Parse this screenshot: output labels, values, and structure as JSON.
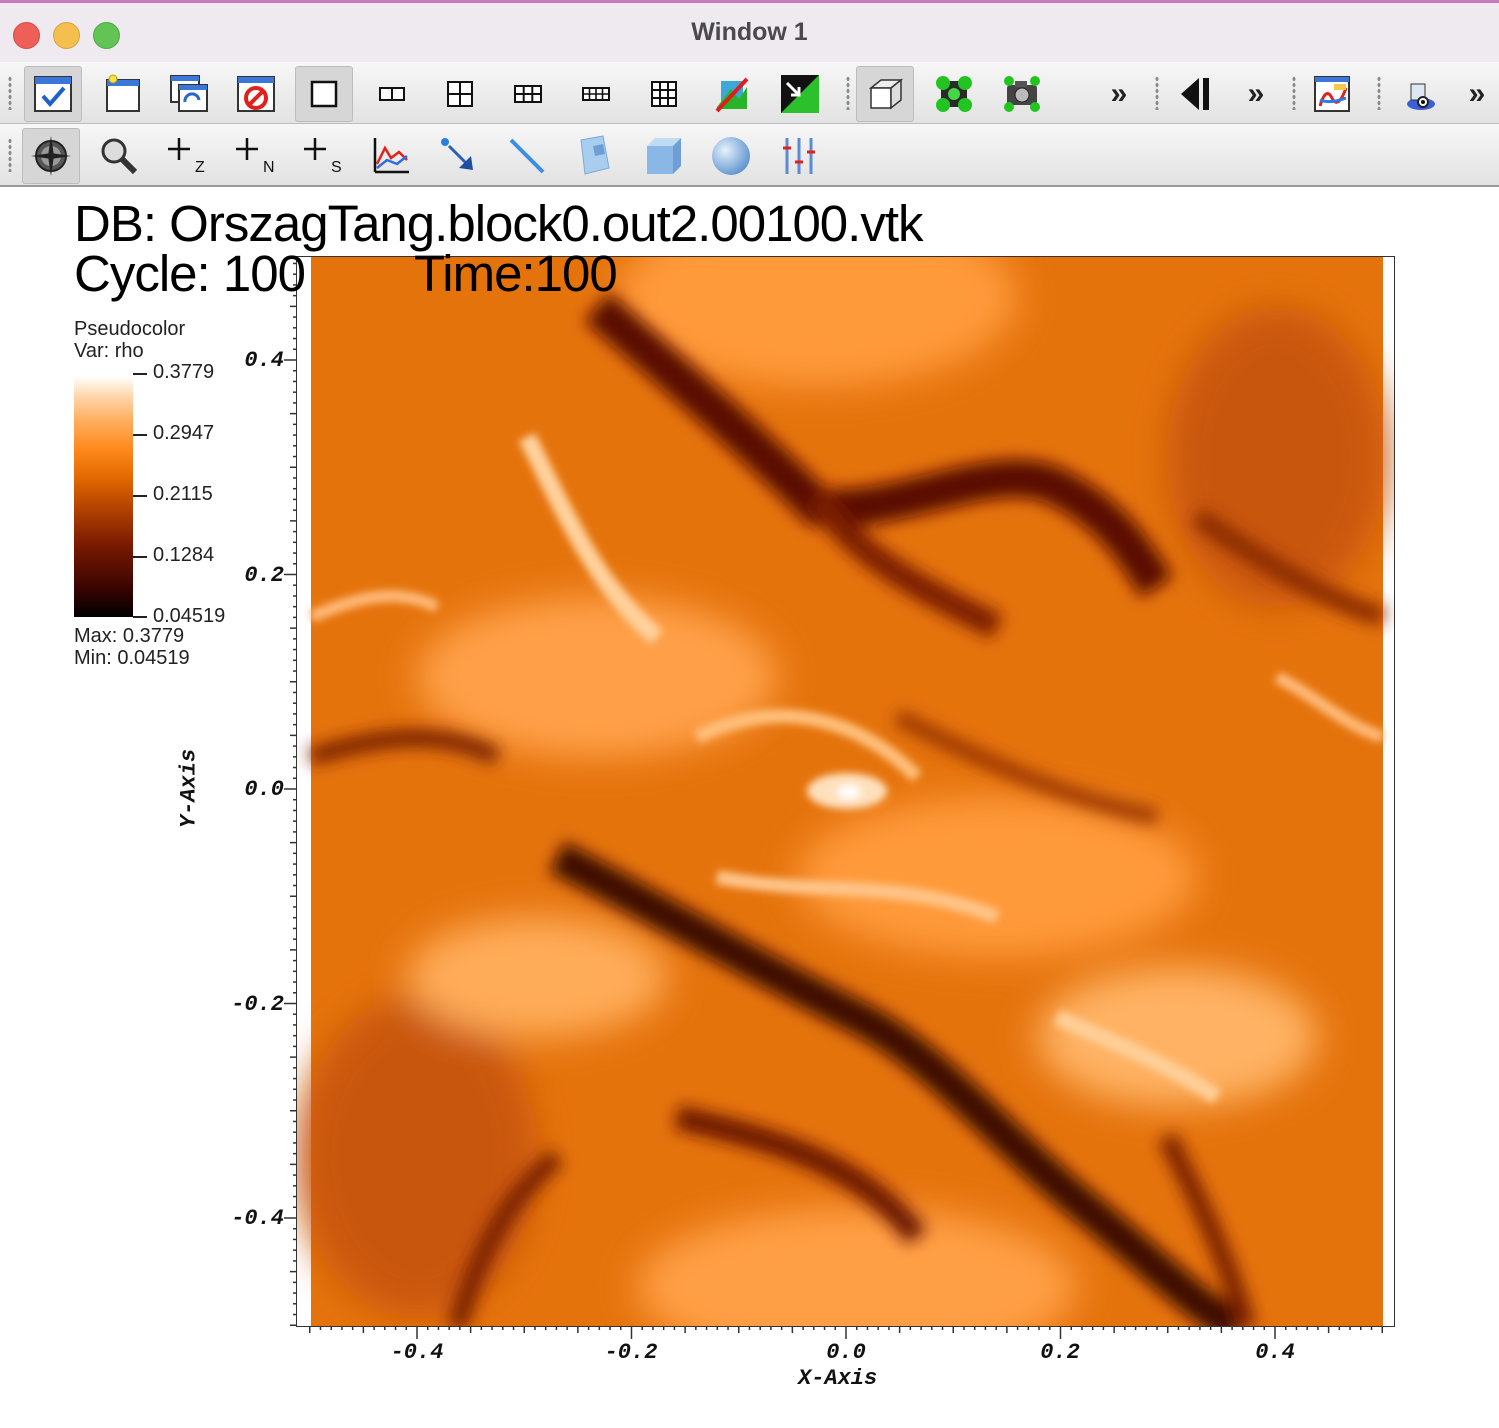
{
  "window": {
    "title": "Window 1"
  },
  "toolbar1": {
    "buttons": [
      "active-window-icon",
      "new-window-icon",
      "clone-window-icon",
      "delete-window-icon",
      "layout-1x1-icon",
      "layout-1x2-icon",
      "layout-2x2-icon",
      "layout-2x3-icon",
      "layout-2x4-icon",
      "layout-3x3-icon",
      "lock-view-icon",
      "invert-view-icon",
      "perspective-icon",
      "copy-attributes-icon",
      "camera-icon",
      "overflow-chevron-icon",
      "animation-reverse-icon",
      "overflow-chevron-icon",
      "color-table-icon",
      "spin-mode-icon",
      "overflow-chevron-icon"
    ],
    "more_label": "»"
  },
  "toolbar2": {
    "buttons": [
      "navigate-icon",
      "zoom-icon",
      "zone-pick-icon",
      "node-pick-icon",
      "spreadsheet-pick-icon",
      "lineout-icon",
      "select-icon",
      "line-tool-icon",
      "plane-tool-icon",
      "box-tool-icon",
      "sphere-tool-icon",
      "axis-restriction-icon"
    ],
    "pick_z_label": "Z",
    "pick_n_label": "N",
    "pick_s_label": "S"
  },
  "annotation": {
    "db": "DB: OrszagTang.block0.out2.00100.vtk",
    "cycle": "Cycle: 100",
    "time": "Time:100"
  },
  "legend": {
    "plot_type": "Pseudocolor",
    "var": "Var: rho",
    "ticks": [
      "0.3779",
      "0.2947",
      "0.2115",
      "0.1284",
      "0.04519"
    ],
    "max_label": "Max:  0.3779",
    "min_label": "Min:  0.04519",
    "colormap": "hot/orange"
  },
  "axes": {
    "y_title": "Y-Axis",
    "x_title": "X-Axis",
    "y_ticks": [
      "0.4",
      "0.2",
      "0.0",
      "-0.2",
      "-0.4"
    ],
    "x_ticks": [
      "-0.4",
      "-0.2",
      "0.0",
      "0.2",
      "0.4"
    ]
  },
  "chart_data": {
    "type": "heatmap",
    "title": "",
    "xlabel": "X-Axis",
    "ylabel": "Y-Axis",
    "xlim": [
      -0.5,
      0.5
    ],
    "ylim": [
      -0.5,
      0.5
    ],
    "variable": "rho",
    "value_range": [
      0.04519,
      0.3779
    ]
  }
}
